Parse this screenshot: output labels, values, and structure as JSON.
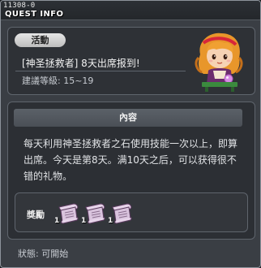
{
  "window": {
    "quest_id": "11308-0",
    "title": "QUEST INFO"
  },
  "quest": {
    "category": "活動",
    "name": "[神圣拯救者] 8天出席报到!",
    "level": "建議等級: 15~19",
    "npc_icon": "npc-portrait-icon"
  },
  "content": {
    "header": "內容",
    "text": "每天利用神圣拯救者之石使用技能一次以上，即算出席。今天是第8天。满10天之后，可以获得很不错的礼物。"
  },
  "reward": {
    "label": "獎勵",
    "items": [
      {
        "icon": "scroll-icon",
        "qty": "1"
      },
      {
        "icon": "scroll-icon",
        "qty": "1"
      },
      {
        "icon": "scroll-icon",
        "qty": "1"
      }
    ]
  },
  "status": "狀態: 可開始",
  "colors": {
    "window_bg": "#3a3e44",
    "panel_bg": "#2c2f34",
    "header_bg": "#525860",
    "badge_bg": "#d4d4d4",
    "scroll_color": "#d9c3dd"
  }
}
